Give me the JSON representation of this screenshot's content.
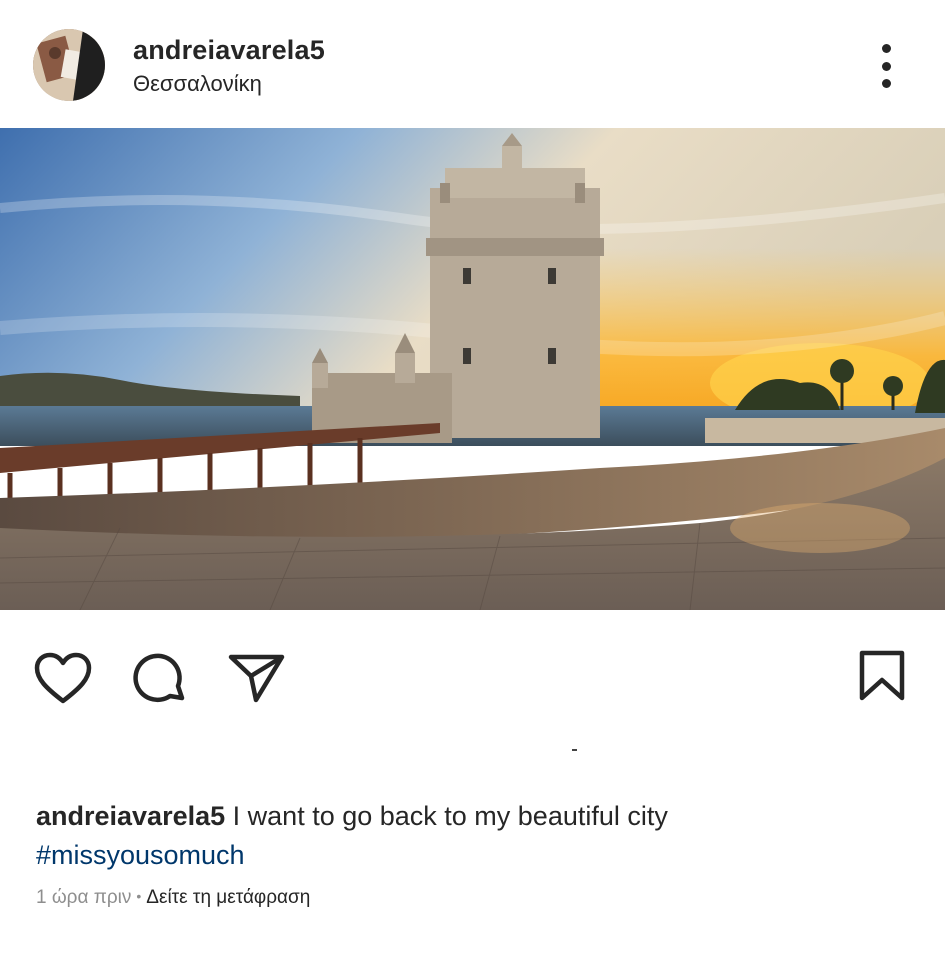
{
  "post": {
    "username": "andreiavarela5",
    "location": "Θεσσαλονίκη",
    "caption_user": "andreiavarela5",
    "caption_text": "I want to go back to my beautiful city",
    "hashtag": "#missyousomuch",
    "time_ago": "1 ώρα πριν",
    "separator": "•",
    "translate_label": "Δείτε τη μετάφραση"
  },
  "icons": {
    "more": "more-options-icon",
    "like": "heart-icon",
    "comment": "comment-icon",
    "share": "paper-plane-icon",
    "save": "bookmark-icon"
  },
  "colors": {
    "text": "#262626",
    "hashtag": "#00376b",
    "muted": "#8e8e8e"
  }
}
